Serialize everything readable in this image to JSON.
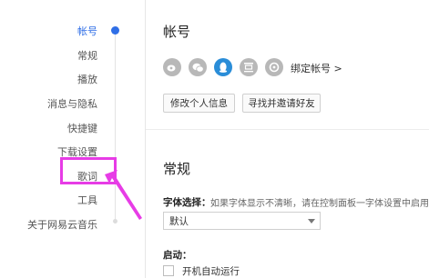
{
  "sidebar": {
    "items": [
      {
        "label": "帐号",
        "active": true
      },
      {
        "label": "常规"
      },
      {
        "label": "播放"
      },
      {
        "label": "消息与隐私"
      },
      {
        "label": "快捷键"
      },
      {
        "label": "下载设置"
      },
      {
        "label": "歌词",
        "highlighted": true
      },
      {
        "label": "工具"
      },
      {
        "label": "关于网易云音乐"
      }
    ]
  },
  "account": {
    "title": "帐号",
    "social_icons": [
      "weibo-icon",
      "wechat-icon",
      "qq-icon",
      "douban-icon",
      "yixin-icon"
    ],
    "bind_label": "绑定帐号 >",
    "edit_profile_label": "修改个人信息",
    "find_friends_label": "寻找并邀请好友"
  },
  "general": {
    "title": "常规",
    "font_label": "字体选择：",
    "font_hint": "如果字体显示不清晰，请在控制面板一字体设置中启用",
    "font_value": "默认",
    "startup_label": "启动：",
    "autostart_label": "开机自动运行"
  },
  "colors": {
    "accent": "#2f6ee6",
    "annotation": "#e73ce6"
  }
}
